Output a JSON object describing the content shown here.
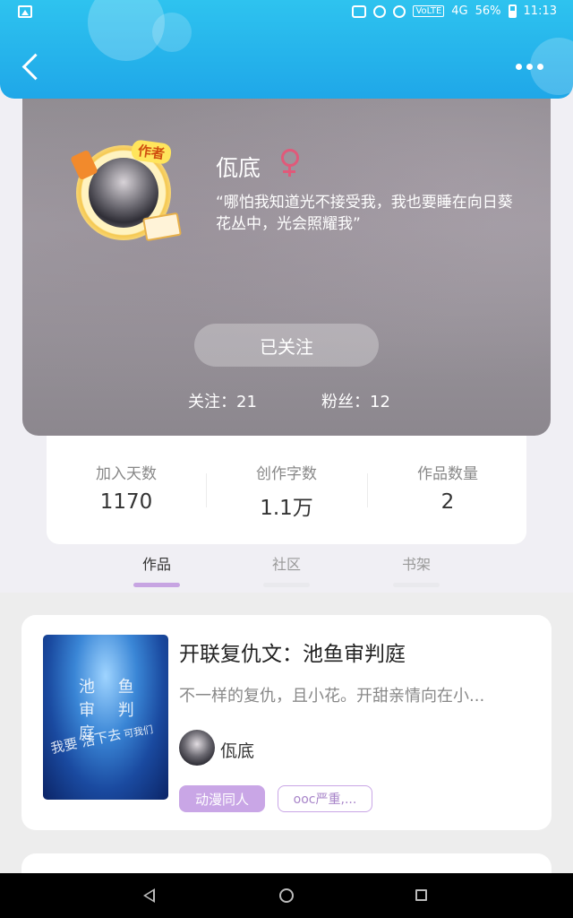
{
  "status_bar": {
    "network": "4G",
    "volte": "VoLTE",
    "battery": "56%",
    "time": "11:13"
  },
  "header": {
    "back_icon": "chevron-left-icon",
    "more_icon": "more-dots-icon"
  },
  "profile": {
    "badge": "作者",
    "name": "佤底",
    "gender_icon": "female-icon",
    "motto": "“哪怕我知道光不接受我，我也要睡在向日葵花丛中，光会照耀我”",
    "follow_button": "已关注",
    "following_label": "关注：21",
    "fans_label": "粉丝：12"
  },
  "stats": [
    {
      "label": "加入天数",
      "value": "1170"
    },
    {
      "label": "创作字数",
      "value": "1.1万"
    },
    {
      "label": "作品数量",
      "value": "2"
    }
  ],
  "tabs": [
    {
      "label": "作品",
      "active": true
    },
    {
      "label": "社区",
      "active": false
    },
    {
      "label": "书架",
      "active": false
    }
  ],
  "works": [
    {
      "title": "开联复仇文：池鱼审判庭",
      "description": "不一样的复仇，且小花。开甜亲情向在小...",
      "author": "佤底",
      "cover_text": [
        "池 鱼",
        "审 判 庭",
        "我要 活下去",
        "可我们"
      ],
      "tags": [
        "动漫同人",
        "ooc严重,..."
      ]
    }
  ],
  "colors": {
    "header": "#22b2ec",
    "accent": "#c9a6e6",
    "female": "#e05a7a"
  }
}
